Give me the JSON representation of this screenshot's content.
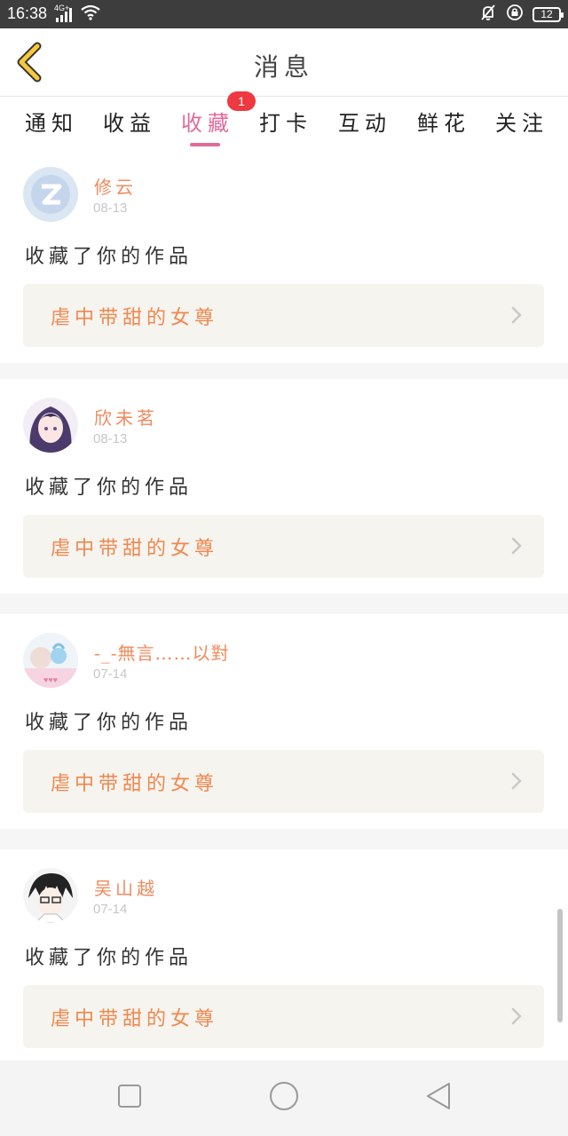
{
  "status_bar": {
    "time": "16:38",
    "network": "4G+",
    "battery": "12"
  },
  "header": {
    "title": "消息"
  },
  "tabs": [
    {
      "label": "通知"
    },
    {
      "label": "收益"
    },
    {
      "label": "收藏",
      "active": true,
      "badge": "1"
    },
    {
      "label": "打卡"
    },
    {
      "label": "互动"
    },
    {
      "label": "鲜花"
    },
    {
      "label": "关注"
    }
  ],
  "messages": [
    {
      "user": "修云",
      "time": "08-13",
      "action": "收藏了你的作品",
      "work": "虐中带甜的女尊",
      "avatar": "qq-default-avatar"
    },
    {
      "user": "欣未茗",
      "time": "08-13",
      "action": "收藏了你的作品",
      "work": "虐中带甜的女尊",
      "avatar": "anime-girl-avatar"
    },
    {
      "user": "-_-無言……以對",
      "time": "07-14",
      "action": "收藏了你的作品",
      "work": "虐中带甜的女尊",
      "avatar": "photo-avatar"
    },
    {
      "user": "吴山越",
      "time": "07-14",
      "action": "收藏了你的作品",
      "work": "虐中带甜的女尊",
      "avatar": "anime-boy-avatar"
    }
  ],
  "colors": {
    "accent": "#e36a9a",
    "username": "#f08a5d",
    "badge": "#ee3940",
    "work_box": "#f5f4ef"
  }
}
